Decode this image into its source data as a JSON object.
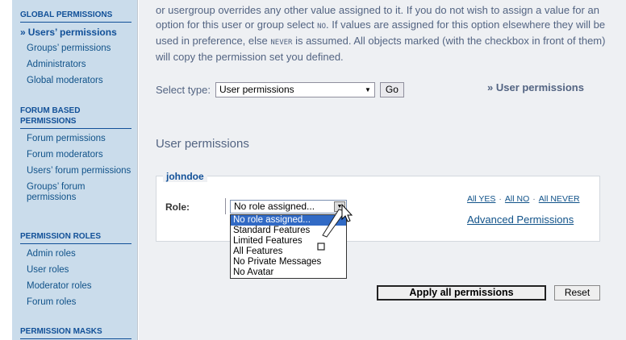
{
  "sidebar": {
    "sections": [
      {
        "title": "GLOBAL PERMISSIONS",
        "items": [
          {
            "label": "Users’ permissions",
            "active": true
          },
          {
            "label": "Groups’ permissions"
          },
          {
            "label": "Administrators"
          },
          {
            "label": "Global moderators"
          }
        ]
      },
      {
        "title": "FORUM BASED PERMISSIONS",
        "items": [
          {
            "label": "Forum permissions"
          },
          {
            "label": "Forum moderators"
          },
          {
            "label": "Users’ forum permissions"
          },
          {
            "label": "Groups’ forum permissions"
          }
        ]
      },
      {
        "title": "PERMISSION ROLES",
        "items": [
          {
            "label": "Admin roles"
          },
          {
            "label": "User roles"
          },
          {
            "label": "Moderator roles"
          },
          {
            "label": "Forum roles"
          }
        ]
      },
      {
        "title": "PERMISSION MASKS",
        "items": []
      }
    ],
    "active_bullet": "»"
  },
  "intro": {
    "part1": "or usergroup overrides any other value assigned to it. If you do not wish to assign a value for an option for this user or group select ",
    "no": "NO",
    "part2": ". If values are assigned for this option elsewhere they will be used in preference, else ",
    "never": "NEVER",
    "part3": " is assumed. All objects marked (with the checkbox in front of them) will copy the permission set you defined."
  },
  "select_type": {
    "label": "Select type:",
    "value": "User permissions",
    "go": "Go",
    "header_link": "» User permissions"
  },
  "section_heading": "User permissions",
  "permission_box": {
    "username": "johndoe",
    "role_label": "Role:",
    "role_value": "No role assigned...",
    "options": [
      "No role assigned...",
      "Standard Features",
      "Limited Features",
      "All Features",
      "No Private Messages",
      "No Avatar"
    ],
    "all_yes": "All YES",
    "all_no": "All NO",
    "all_never": "All NEVER",
    "separator": "·",
    "advanced": "Advanced Permissions"
  },
  "buttons": {
    "apply": "Apply all permissions",
    "reset": "Reset"
  },
  "colors": {
    "sidebar_bg": "#cadceb",
    "main_bg": "#eef0f3",
    "link": "#105289",
    "selected_option": "#316ac5"
  }
}
